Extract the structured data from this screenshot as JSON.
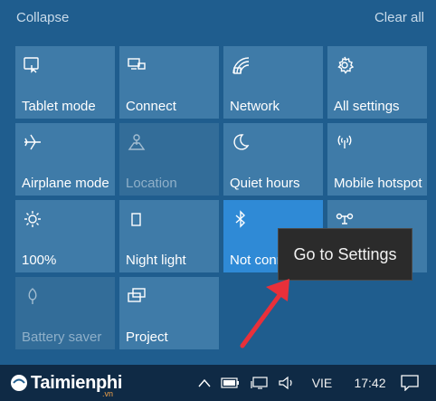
{
  "header": {
    "collapse": "Collapse",
    "clear_all": "Clear all"
  },
  "tiles": [
    {
      "label": "Tablet mode",
      "icon": "tablet-mode-icon",
      "state": "off"
    },
    {
      "label": "Connect",
      "icon": "connect-icon",
      "state": "off"
    },
    {
      "label": "Network",
      "icon": "network-icon",
      "state": "off"
    },
    {
      "label": "All settings",
      "icon": "gear-icon",
      "state": "off"
    },
    {
      "label": "Airplane mode",
      "icon": "airplane-icon",
      "state": "off"
    },
    {
      "label": "Location",
      "icon": "location-icon",
      "state": "disabled"
    },
    {
      "label": "Quiet hours",
      "icon": "moon-icon",
      "state": "off"
    },
    {
      "label": "Mobile hotspot",
      "icon": "hotspot-icon",
      "state": "off"
    },
    {
      "label": "100%",
      "icon": "brightness-icon",
      "state": "off"
    },
    {
      "label": "Night light",
      "icon": "night-light-icon",
      "state": "off"
    },
    {
      "label": "Not conn",
      "icon": "bluetooth-icon",
      "state": "on"
    },
    {
      "label": "",
      "icon": "vpn-icon",
      "state": "off"
    },
    {
      "label": "Battery saver",
      "icon": "battery-saver-icon",
      "state": "disabled"
    },
    {
      "label": "Project",
      "icon": "project-icon",
      "state": "off"
    }
  ],
  "tooltip": {
    "text": "Go to Settings"
  },
  "taskbar": {
    "logo_main": "Taimienphi",
    "logo_sub": ".vn",
    "language": "VIE",
    "time": "17:42"
  },
  "colors": {
    "background": "#1f5d8e",
    "tile": "#3f7ba8",
    "tile_active": "#2f8ad6",
    "arrow": "#e8303a"
  }
}
